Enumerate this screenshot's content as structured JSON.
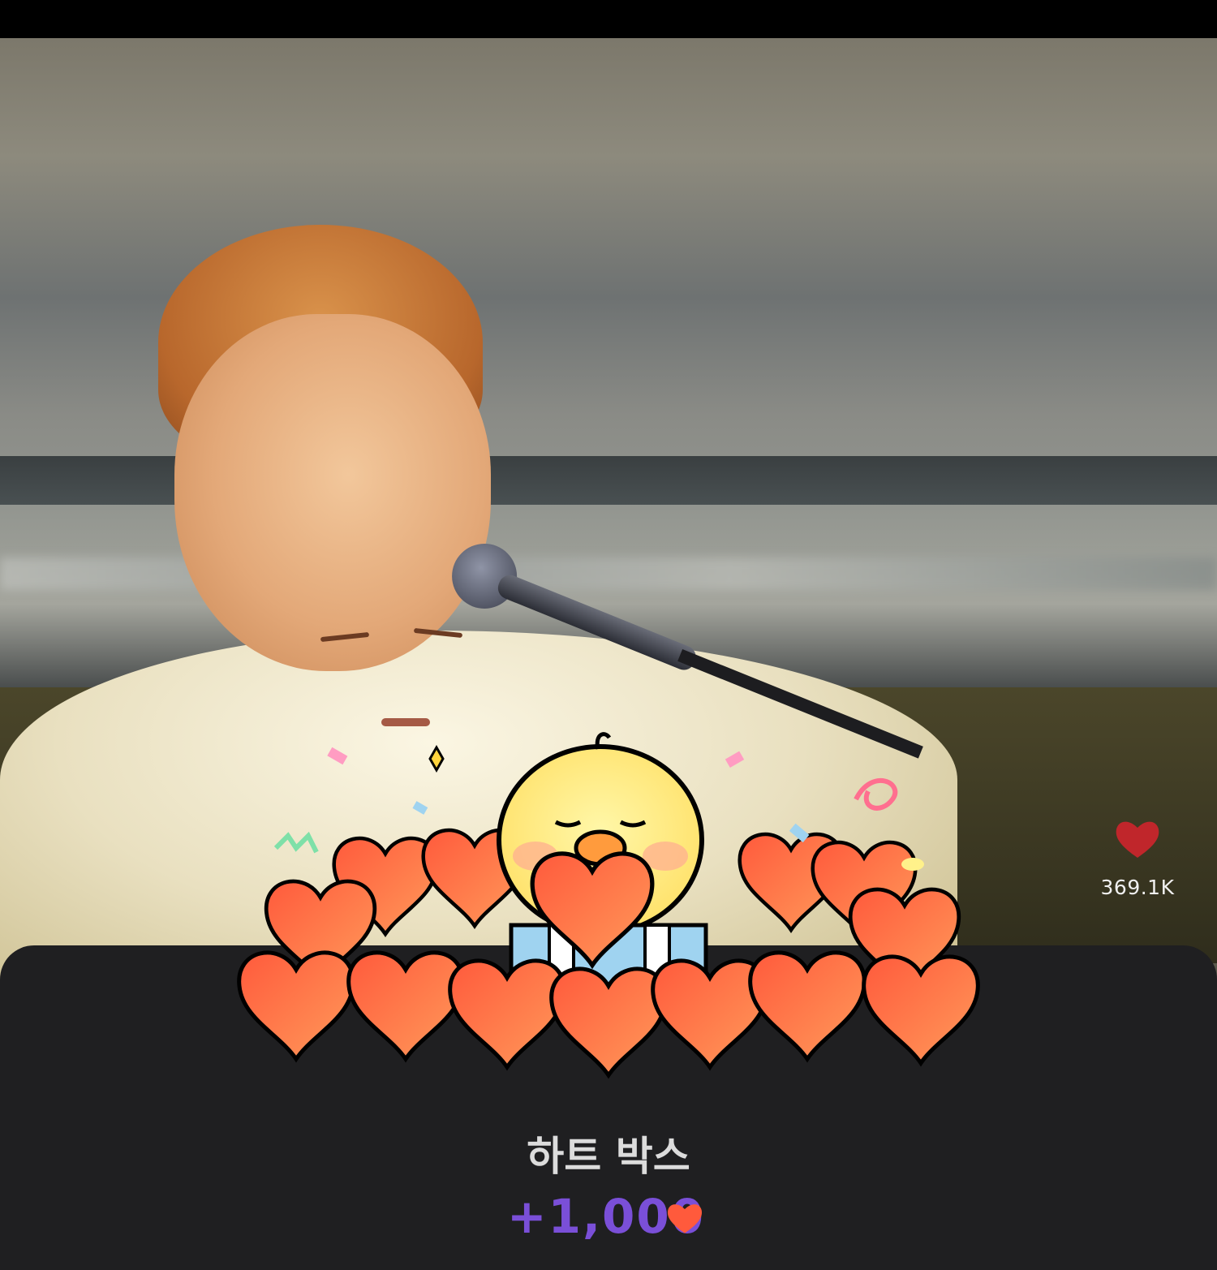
{
  "live": {
    "like_icon": "heart-icon",
    "like_count": "369.1K",
    "like_color": "#c0262b"
  },
  "gift_sheet": {
    "title": "하트 박스",
    "amount": "+1,000",
    "amount_icon": "heart-icon",
    "amount_color": "#7a4fd8",
    "sticker": "chick-holding-heart-sticker"
  }
}
